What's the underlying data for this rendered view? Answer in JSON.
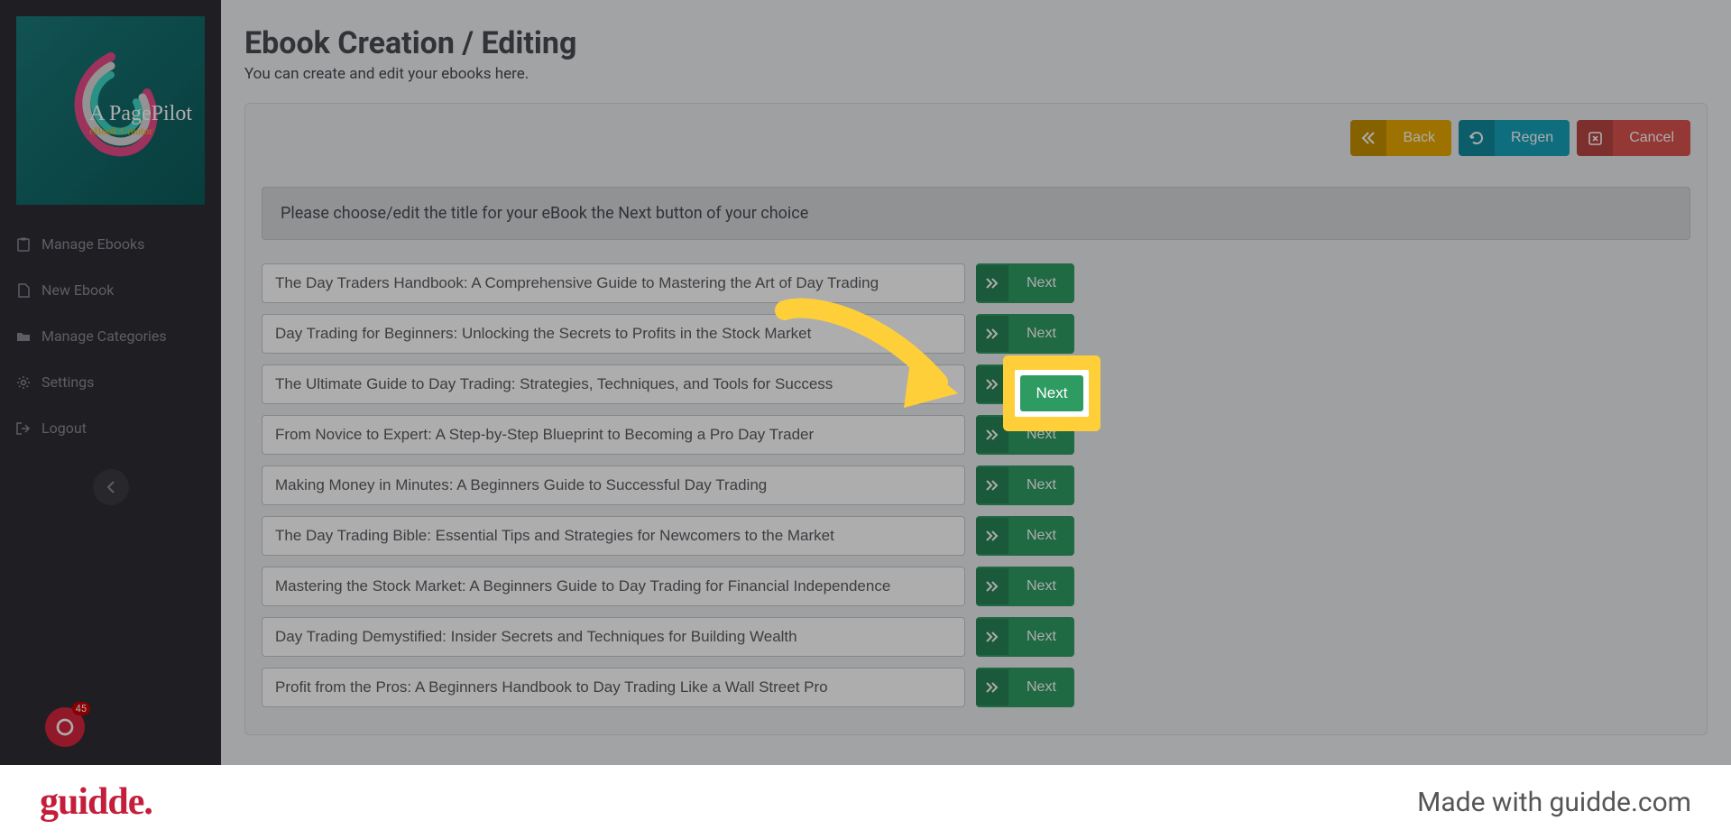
{
  "logo": {
    "brand": "A PagePilot",
    "sub": "eBook Creator"
  },
  "sidebar": {
    "items": [
      {
        "icon": "clipboard",
        "label": "Manage Ebooks"
      },
      {
        "icon": "file",
        "label": "New Ebook"
      },
      {
        "icon": "folder",
        "label": "Manage Categories"
      },
      {
        "icon": "gear",
        "label": "Settings"
      },
      {
        "icon": "logout",
        "label": "Logout"
      }
    ],
    "badge": "45"
  },
  "page": {
    "title": "Ebook Creation / Editing",
    "subtitle": "You can create and edit your ebooks here."
  },
  "actions": {
    "back": "Back",
    "regen": "Regen",
    "cancel": "Cancel"
  },
  "instruction": "Please choose/edit the title for your eBook the Next button of your choice",
  "next_label": "Next",
  "titles": [
    "The Day Traders Handbook: A Comprehensive Guide to Mastering the Art of Day Trading",
    "Day Trading for Beginners: Unlocking the Secrets to Profits in the Stock Market",
    "The Ultimate Guide to Day Trading: Strategies, Techniques, and Tools for Success",
    "From Novice to Expert: A Step-by-Step Blueprint to Becoming a Pro Day Trader",
    "Making Money in Minutes: A Beginners Guide to Successful Day Trading",
    "The Day Trading Bible: Essential Tips and Strategies for Newcomers to the Market",
    "Mastering the Stock Market: A Beginners Guide to Day Trading for Financial Independence",
    "Day Trading Demystified: Insider Secrets and Techniques for Building Wealth",
    "Profit from the Pros: A Beginners Handbook to Day Trading Like a Wall Street Pro"
  ],
  "highlight_next": "Next",
  "footer": {
    "logo": "guidde.",
    "text": "Made with guidde.com"
  }
}
